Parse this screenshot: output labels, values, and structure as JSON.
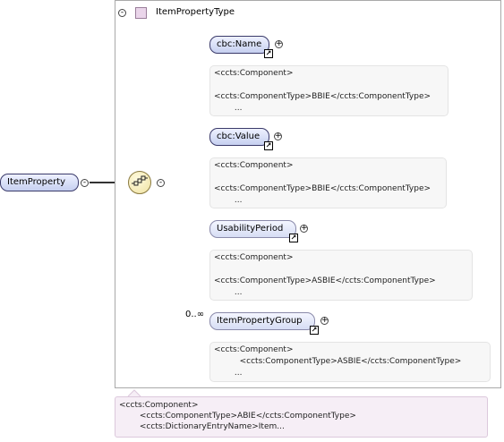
{
  "container": {
    "title": "ItemPropertyType",
    "toggle": "-"
  },
  "root": {
    "label": "ItemProperty",
    "toggle": "-",
    "doc": "<ccts:Component>\n        <ccts:ComponentType>ABIE</ccts:ComponentType>\n        <ccts:DictionaryEntryName>Item..."
  },
  "sequence": {
    "toggle": "-"
  },
  "children": [
    {
      "label": "cbc:Name",
      "required": true,
      "reference": true,
      "expand": "+",
      "doc": "<ccts:Component>\n\n<ccts:ComponentType>BBIE</ccts:ComponentType>\n        ..."
    },
    {
      "label": "cbc:Value",
      "required": true,
      "reference": true,
      "expand": "+",
      "doc": "<ccts:Component>\n\n<ccts:ComponentType>BBIE</ccts:ComponentType>\n        ..."
    },
    {
      "label": "UsabilityPeriod",
      "required": false,
      "reference": true,
      "expand": "+",
      "doc": "<ccts:Component>\n\n<ccts:ComponentType>ASBIE</ccts:ComponentType>\n        ..."
    },
    {
      "label": "ItemPropertyGroup",
      "required": false,
      "reference": true,
      "expand": "+",
      "occurs": "0..∞",
      "doc": "<ccts:Component>\n          <ccts:ComponentType>ASBIE</ccts:ComponentType>\n        ..."
    }
  ]
}
